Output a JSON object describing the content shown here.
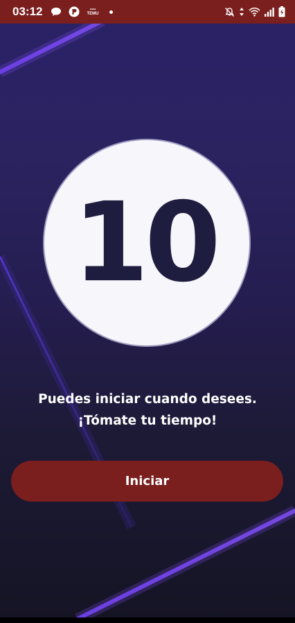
{
  "status_bar": {
    "time": "03:12",
    "app_badge_text": "TEMU",
    "icons": [
      "chat-bubble-icon",
      "p-app-icon",
      "temu-icon",
      "notification-dot",
      "bell-off-icon",
      "data-arrows-icon",
      "wifi-icon",
      "signal-icon",
      "battery-charging-icon"
    ]
  },
  "countdown": {
    "value": "10"
  },
  "message": "Puedes iniciar cuando desees. ¡Tómate tu tiempo!",
  "start_button": {
    "label": "Iniciar"
  },
  "colors": {
    "status_bar_bg": "#7a1e1e",
    "button_bg": "#7a1e1e",
    "circle_bg": "#f6f6fb",
    "number_color": "#1f1d3f",
    "streak_color": "#6a3de8"
  }
}
